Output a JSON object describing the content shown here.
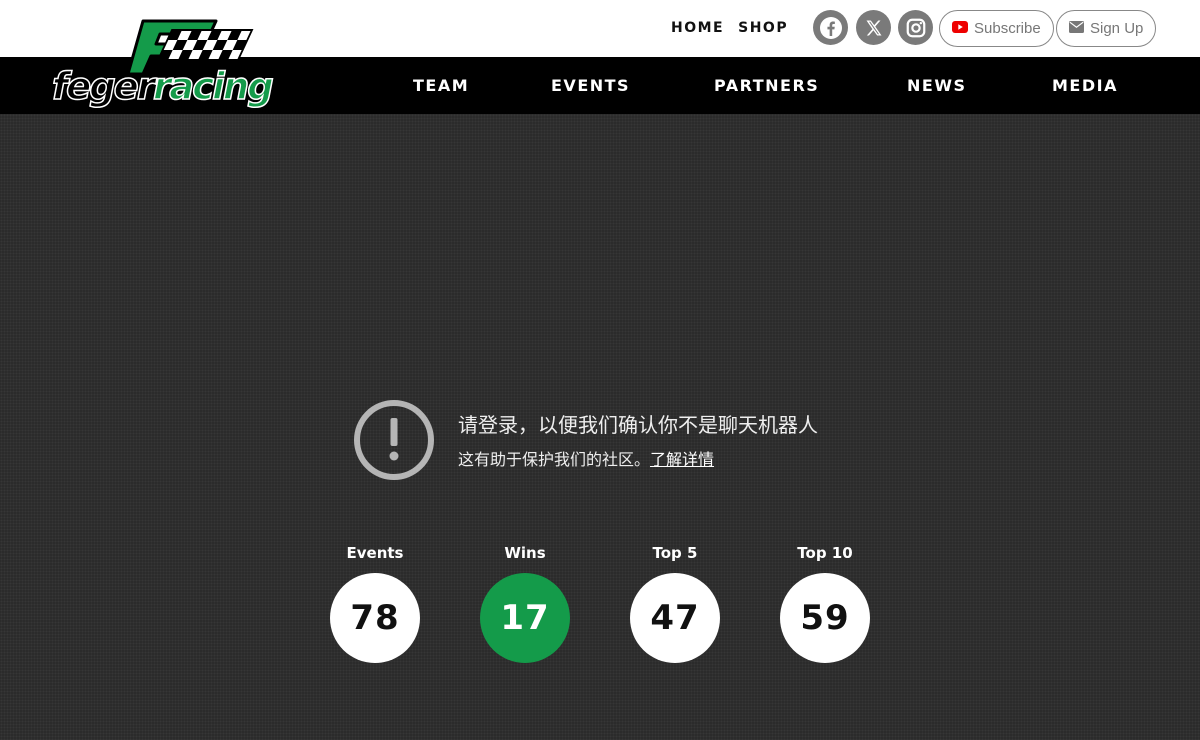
{
  "brand": {
    "logo_part1": "feger",
    "logo_part2": "racing",
    "green": "#149b4a"
  },
  "top_nav": {
    "links": [
      "HOME",
      "SHOP"
    ],
    "social": [
      "facebook-icon",
      "x-icon",
      "instagram-icon"
    ],
    "subscribe_label": "Subscribe",
    "signup_label": "Sign Up"
  },
  "main_nav": {
    "items": [
      "TEAM",
      "EVENTS",
      "PARTNERS",
      "NEWS",
      "MEDIA"
    ]
  },
  "captcha": {
    "title": "请登录，以便我们确认你不是聊天机器人",
    "subtitle": "这有助于保护我们的社区。",
    "link": "了解详情"
  },
  "stats": [
    {
      "label": "Events",
      "value": "78",
      "highlight": false
    },
    {
      "label": "Wins",
      "value": "17",
      "highlight": true
    },
    {
      "label": "Top 5",
      "value": "47",
      "highlight": false
    },
    {
      "label": "Top 10",
      "value": "59",
      "highlight": false
    }
  ]
}
